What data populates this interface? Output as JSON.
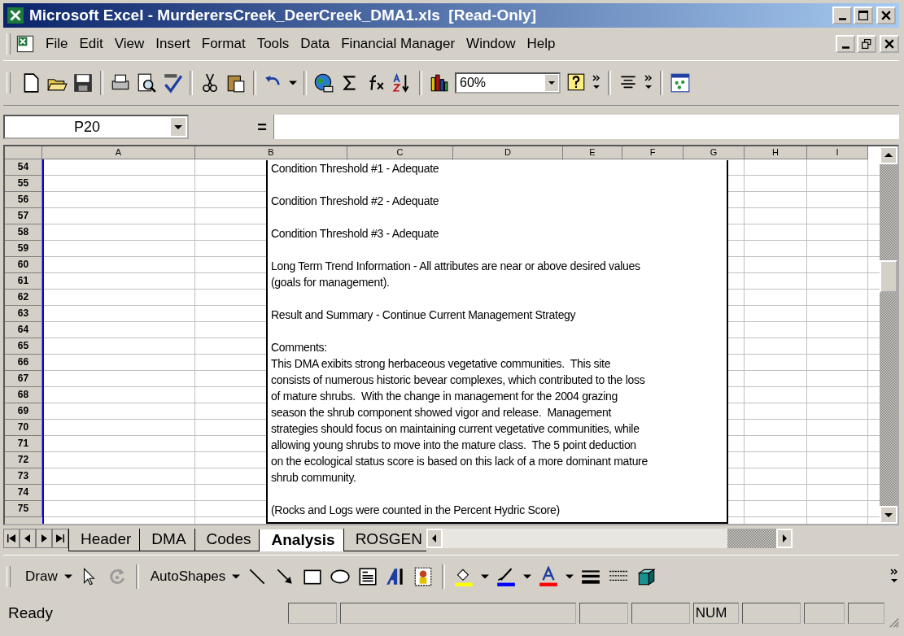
{
  "window": {
    "title": "Microsoft Excel - MurderersCreek_DeerCreek_DMA1.xls  [Read-Only]"
  },
  "menu": [
    "File",
    "Edit",
    "View",
    "Insert",
    "Format",
    "Tools",
    "Data",
    "Financial Manager",
    "Window",
    "Help"
  ],
  "toolbar": {
    "zoom": "60%"
  },
  "formula_bar": {
    "name_box": "P20",
    "equals": "="
  },
  "sheet": {
    "columns": [
      "A",
      "B",
      "C",
      "D",
      "E",
      "F",
      "G",
      "H",
      "I"
    ],
    "rows": [
      "54",
      "55",
      "56",
      "57",
      "58",
      "59",
      "60",
      "61",
      "62",
      "63",
      "64",
      "65",
      "66",
      "67",
      "68",
      "69",
      "70",
      "71",
      "72",
      "73",
      "74",
      "75"
    ]
  },
  "text_box": {
    "paragraphs": [
      [
        "Condition Threshold #1 - Adequate"
      ],
      [
        "Condition Threshold #2 - Adequate"
      ],
      [
        "Condition Threshold #3 - Adequate"
      ],
      [
        "Long Term Trend Information - All attributes are near or above desired values",
        "(goals for management)."
      ],
      [
        "Result and Summary - Continue Current Management Strategy"
      ],
      [
        "Comments:",
        "This DMA exibits strong herbaceous vegetative communities.  This site",
        "consists of numerous historic bevear complexes, which contributed to the loss",
        "of mature shrubs.  With the change in management for the 2004 grazing",
        "season the shrub component showed vigor and release.  Management",
        "strategies should focus on maintaining current vegetative communities, while",
        "allowing young shrubs to move into the mature class.  The 5 point deduction",
        "on the ecological status score is based on this lack of a more dominant mature",
        "shrub community."
      ],
      [
        "(Rocks and Logs were counted in the Percent Hydric Score)"
      ]
    ]
  },
  "sheet_tabs": [
    {
      "label": "Header",
      "selected": false
    },
    {
      "label": "DMA",
      "selected": false
    },
    {
      "label": "Codes",
      "selected": false
    },
    {
      "label": "Analysis",
      "selected": true
    },
    {
      "label": "ROSGEN",
      "selected": false
    }
  ],
  "drawing_toolbar": {
    "draw": "Draw",
    "autoshapes": "AutoShapes"
  },
  "status_bar": {
    "status": "Ready",
    "num": "NUM"
  }
}
